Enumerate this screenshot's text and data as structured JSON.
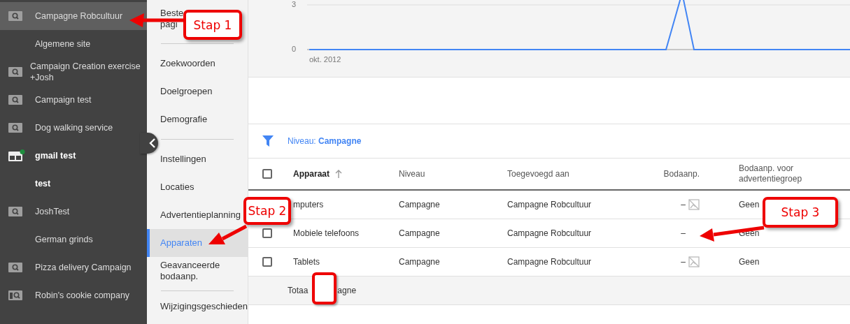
{
  "accounts": [
    {
      "name": "Campagne Robcultuur",
      "kind": "search",
      "selected": true,
      "bold": false
    },
    {
      "name": "Algemene site",
      "kind": "plain",
      "selected": false,
      "bold": false
    },
    {
      "name": "Campaign Creation exercise +Josh",
      "kind": "search",
      "selected": false,
      "bold": false
    },
    {
      "name": "Campaign test",
      "kind": "search",
      "selected": false,
      "bold": false
    },
    {
      "name": "Dog walking service",
      "kind": "search",
      "selected": false,
      "bold": false
    },
    {
      "name": "gmail test",
      "kind": "display",
      "selected": false,
      "bold": true
    },
    {
      "name": "test",
      "kind": "plain",
      "selected": false,
      "bold": true
    },
    {
      "name": "JoshTest",
      "kind": "search",
      "selected": false,
      "bold": false
    },
    {
      "name": "German grinds",
      "kind": "plain",
      "selected": false,
      "bold": false
    },
    {
      "name": "Pizza delivery Campaign",
      "kind": "search",
      "selected": false,
      "bold": false
    },
    {
      "name": "Robin's cookie company",
      "kind": "page",
      "selected": false,
      "bold": false
    }
  ],
  "nav": [
    {
      "kind": "item",
      "label": "Beste pagi",
      "selected": false
    },
    {
      "kind": "divider"
    },
    {
      "kind": "item",
      "label": "Zoekwoorden",
      "selected": false
    },
    {
      "kind": "item",
      "label": "Doelgroepen",
      "selected": false
    },
    {
      "kind": "item",
      "label": "Demografie",
      "selected": false
    },
    {
      "kind": "divider"
    },
    {
      "kind": "item",
      "label": "Instellingen",
      "selected": false
    },
    {
      "kind": "item",
      "label": "Locaties",
      "selected": false
    },
    {
      "kind": "item",
      "label": "Advertentieplanning",
      "selected": false
    },
    {
      "kind": "item",
      "label": "Apparaten",
      "selected": true
    },
    {
      "kind": "item",
      "label": "Geavanceerde bodaanp.",
      "selected": false
    },
    {
      "kind": "divider"
    },
    {
      "kind": "item",
      "label": "Wijzigingsgeschieden",
      "selected": false
    }
  ],
  "chart": {
    "y_labels": [
      "3",
      "0"
    ],
    "x_label": "okt. 2012"
  },
  "filter": {
    "label": "Niveau:",
    "value": "Campagne"
  },
  "table": {
    "select_all_checked": false,
    "columns": [
      "Apparaat",
      "Niveau",
      "Toegevoegd aan",
      "Bodaanp.",
      "Bodaanp. voor advertentiegroep"
    ],
    "rows": [
      {
        "device": "mputers",
        "level": "Campagne",
        "added_to": "Campagne Robcultuur",
        "bid": "–",
        "bid_icon": true,
        "group_bid": "Geen"
      },
      {
        "checked": false,
        "device": "Mobiele telefoons",
        "level": "Campagne",
        "added_to": "Campagne Robcultuur",
        "bid": "–",
        "bid_icon": false,
        "group_bid": "Geen"
      },
      {
        "checked": false,
        "device": "Tablets",
        "level": "Campagne",
        "added_to": "Campagne Robcultuur",
        "bid": "–",
        "bid_icon": true,
        "group_bid": "Geen"
      }
    ],
    "total": [
      "Totaa",
      "agne"
    ]
  },
  "callouts": [
    "Stap 1",
    "Stap 2",
    "Stap 3"
  ]
}
